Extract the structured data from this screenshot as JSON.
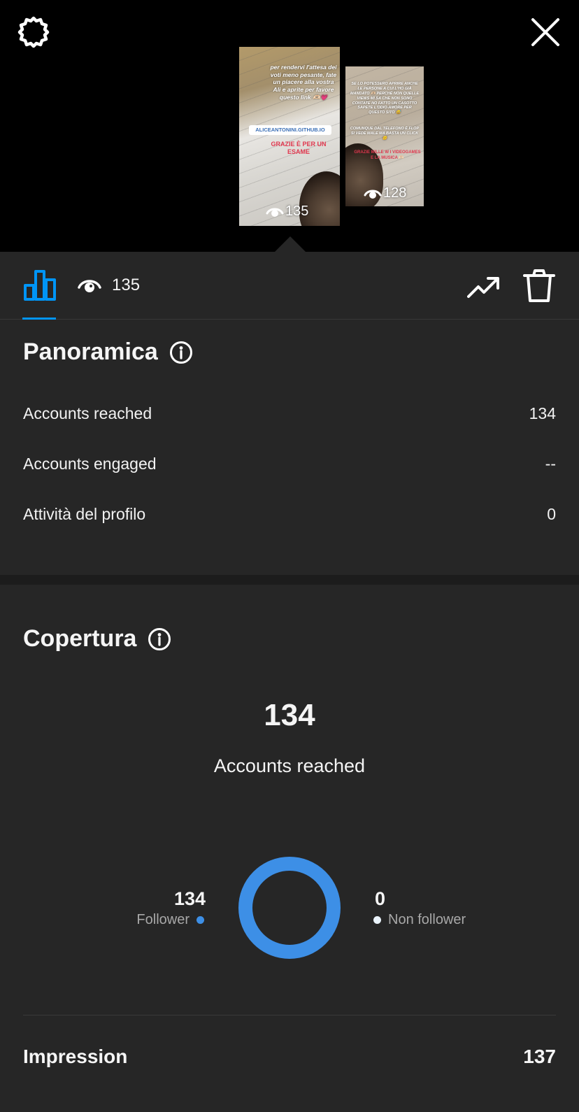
{
  "header": {
    "settings_icon": "gear-icon",
    "close_icon": "close-icon",
    "stories": [
      {
        "views": "135",
        "caption": "per rendervi l'attesa dei voti meno pesante, fate un piacere alla vostra Ali e aprite per favore questo link 🫶🏻💗",
        "link_sticker": "ALICEANTONINI.GITHUB.IO",
        "red_text": "GRAZIE È PER UN ESAME"
      },
      {
        "views": "128",
        "caption_top": "SE LO POTESSERO APRIRE ANCHE LE PERSONE A CUI L'HO GIÀ MANDATO 🫶🏻 PERCHÉ NON QUELLE VIEWS MI SA CHE NON SONO CONTATE NO FATTO UN CASOTTO SAPETE L'ODIO-AMORE PER QUESTO SITO 😅",
        "caption_mid": "COMUNQUE DAL TELEFONO È FLOP SI VEDE MALE MA BASTA UN CLICK 😊",
        "red_text": "GRAZIE MILLE W I VIDEOGAMES E LA MUSICA 🫶🏻"
      }
    ]
  },
  "tabbar": {
    "views_count": "135",
    "icons": [
      "bar-chart-icon",
      "eye-icon",
      "trend-icon",
      "trash-icon"
    ],
    "active_color": "#0095f6"
  },
  "overview": {
    "title": "Panoramica",
    "rows": [
      {
        "label": "Accounts reached",
        "value": "134"
      },
      {
        "label": "Accounts engaged",
        "value": "--"
      },
      {
        "label": "Attività del profilo",
        "value": "0"
      }
    ]
  },
  "reach": {
    "title": "Copertura",
    "total": "134",
    "total_label": "Accounts reached",
    "followers": {
      "value": "134",
      "label": "Follower",
      "color": "#3d8fe6"
    },
    "non_followers": {
      "value": "0",
      "label": "Non follower",
      "color": "#eaf3fb"
    }
  },
  "impressions": {
    "label": "Impression",
    "value": "137"
  }
}
